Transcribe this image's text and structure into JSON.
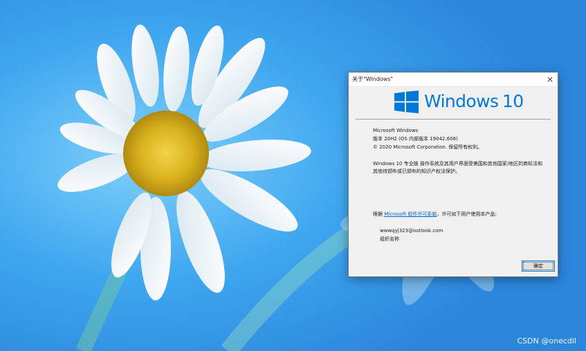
{
  "dialog": {
    "title": "关于\"Windows\"",
    "close_icon": "close-icon",
    "logo_word": "Windows",
    "logo_version": "10",
    "product": "Microsoft Windows",
    "version_line": "版本 20H2 (OS 内部版本 19042.608)",
    "copyright": "© 2020 Microsoft Corporation. 保留所有权利。",
    "description_1": "Windows 10 专业版 操作系统及其用户界面受美国和其他国家/地区的商标法和",
    "description_2": "其他待颁布或已颁布的知识产权法保护。",
    "license_prefix": "根据 ",
    "license_link": "Microsoft 软件许可条款",
    "license_suffix": "，许可如下用户使用本产品:",
    "user_email": "wwwqyj323@outlook.com",
    "org_name": "组织名称",
    "ok_label": "确定"
  },
  "watermark": "CSDN @onecdll",
  "colors": {
    "accent": "#0078d7",
    "link": "#0066cc",
    "wallpaper": "#3aa4f0"
  }
}
